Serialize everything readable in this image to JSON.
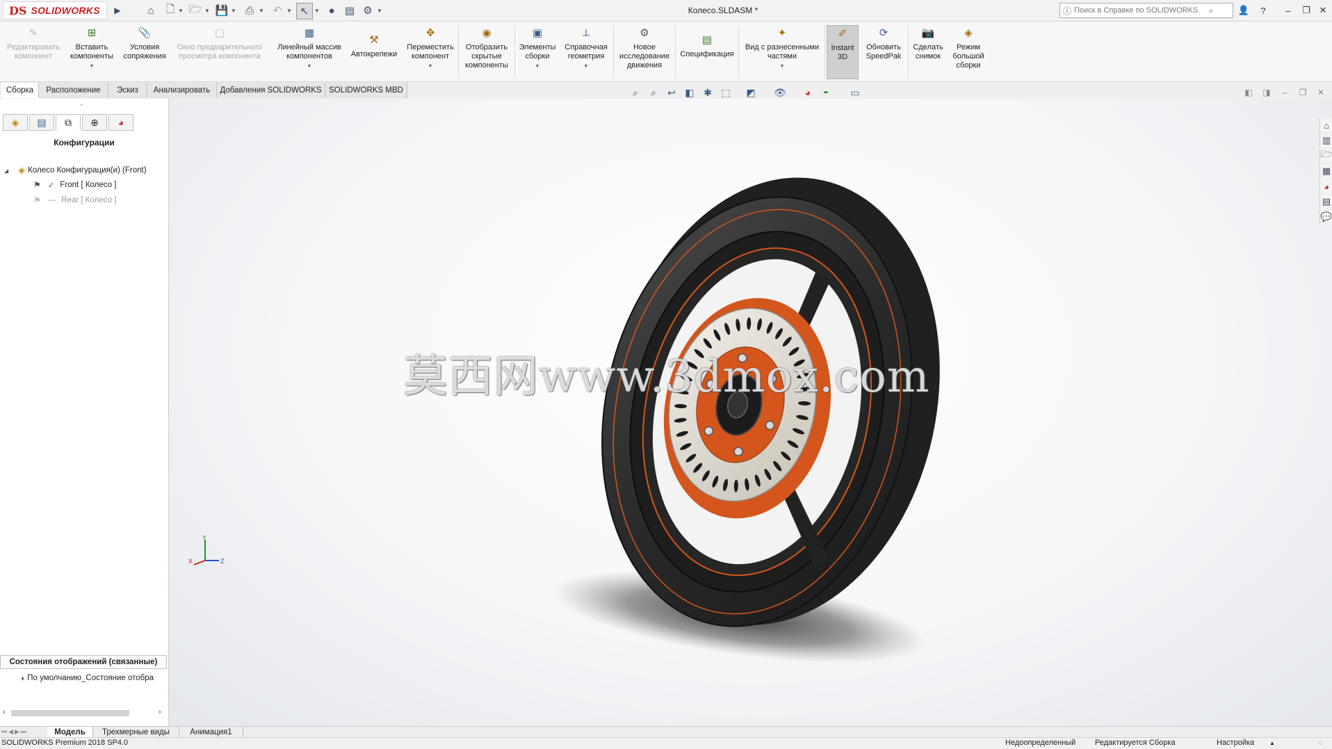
{
  "app": {
    "brand": "SOLIDWORKS",
    "brand_prefix": "DS"
  },
  "window": {
    "title": "Колесо.SLDASM *"
  },
  "help_search": {
    "placeholder": "Поиск в Справке по SOLIDWORKS"
  },
  "command_manager": [
    {
      "label": "Редактировать\nкомпонент",
      "icon": "edit-component-icon",
      "enabled": false
    },
    {
      "label": "Вставить\nкомпоненты",
      "icon": "insert-components-icon",
      "enabled": true
    },
    {
      "label": "Условия\nсопряжения",
      "icon": "mate-icon",
      "enabled": true
    },
    {
      "label": "Окно предварительного\nпросмотра компонента",
      "icon": "preview-window-icon",
      "enabled": false
    },
    {
      "label": "Линейный массив\nкомпонентов",
      "icon": "linear-pattern-icon",
      "enabled": true
    },
    {
      "label": "Автокрепежи",
      "icon": "smart-fasteners-icon",
      "enabled": true
    },
    {
      "label": "Переместить\nкомпонент",
      "icon": "move-component-icon",
      "enabled": true
    },
    {
      "label": "Отобразить\nскрытые\nкомпоненты",
      "icon": "show-hidden-icon",
      "enabled": true
    },
    {
      "label": "Элементы\nсборки",
      "icon": "assembly-features-icon",
      "enabled": true
    },
    {
      "label": "Справочная\nгеометрия",
      "icon": "reference-geometry-icon",
      "enabled": true
    },
    {
      "label": "Новое\nисследование\nдвижения",
      "icon": "motion-study-icon",
      "enabled": true
    },
    {
      "label": "Спецификация",
      "icon": "bom-icon",
      "enabled": true
    },
    {
      "label": "Вид с разнесенными\nчастями",
      "icon": "exploded-view-icon",
      "enabled": true
    },
    {
      "label": "Instant\n3D",
      "icon": "instant3d-icon",
      "enabled": true
    },
    {
      "label": "Обновить\nSpeedPak",
      "icon": "speedpak-icon",
      "enabled": true
    },
    {
      "label": "Сделать\nснимок",
      "icon": "snapshot-icon",
      "enabled": true
    },
    {
      "label": "Режим\nбольшой\nсборки",
      "icon": "large-assembly-icon",
      "enabled": true
    }
  ],
  "tabs": [
    "Сборка",
    "Расположение",
    "Эскиз",
    "Анализировать",
    "Добавления SOLIDWORKS",
    "SOLIDWORKS MBD"
  ],
  "active_tab": "Сборка",
  "panel": {
    "title": "Конфигурации",
    "tree": {
      "root": "Колесо Конфигурация(и)  (Front)",
      "items": [
        {
          "label": "Front [ Колесо ]",
          "active": true
        },
        {
          "label": "Rear [ Колесо ]",
          "active": false
        }
      ]
    },
    "display_states_header": "Состояния отображений (связанные)",
    "display_state_item": "По умолчанию_Состояние отобра"
  },
  "bottom_tabs": [
    "Модель",
    "Трехмерные виды",
    "Анимация1"
  ],
  "active_bottom_tab": "Модель",
  "status": {
    "product": "SOLIDWORKS Premium 2018 SP4.0",
    "definition": "Недоопределенный",
    "editing": "Редактируется Сборка",
    "settings": "Настройка"
  },
  "watermark": "莫西网www.3dmox.com",
  "colors": {
    "brand_red": "#d01c1c",
    "rotor_orange": "#d4561c",
    "tire": "#2a2a2a"
  },
  "triad": {
    "x": "X",
    "y": "Y",
    "z": "Z"
  }
}
